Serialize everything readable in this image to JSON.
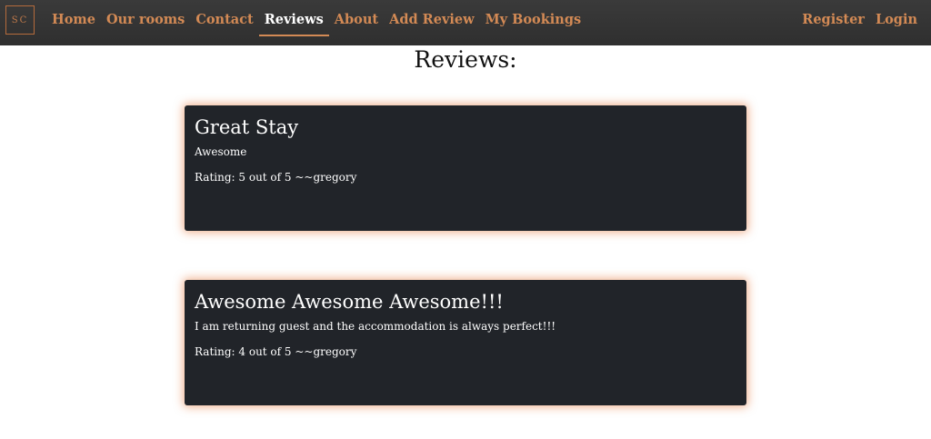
{
  "nav": {
    "logo_text": "SC",
    "left_links": [
      "Home",
      "Our rooms",
      "Contact",
      "Reviews",
      "About",
      "Add Review",
      "My Bookings"
    ],
    "active_link": "Reviews",
    "right_links": [
      "Register",
      "Login"
    ]
  },
  "page": {
    "title": "Reviews:"
  },
  "reviews": [
    {
      "title": "Great Stay",
      "body": "Awesome",
      "rating_text": "Rating: 5 out of 5 ~~gregory"
    },
    {
      "title": "Awesome Awesome Awesome!!!",
      "body": "I am returning guest and the accommodation is always perfect!!!",
      "rating_text": "Rating: 4 out of 5 ~~gregory"
    }
  ],
  "colors": {
    "navbar_bg": "#333333",
    "nav_link": "#d38a55",
    "card_bg": "#212429",
    "card_glow": "#e6783c"
  }
}
